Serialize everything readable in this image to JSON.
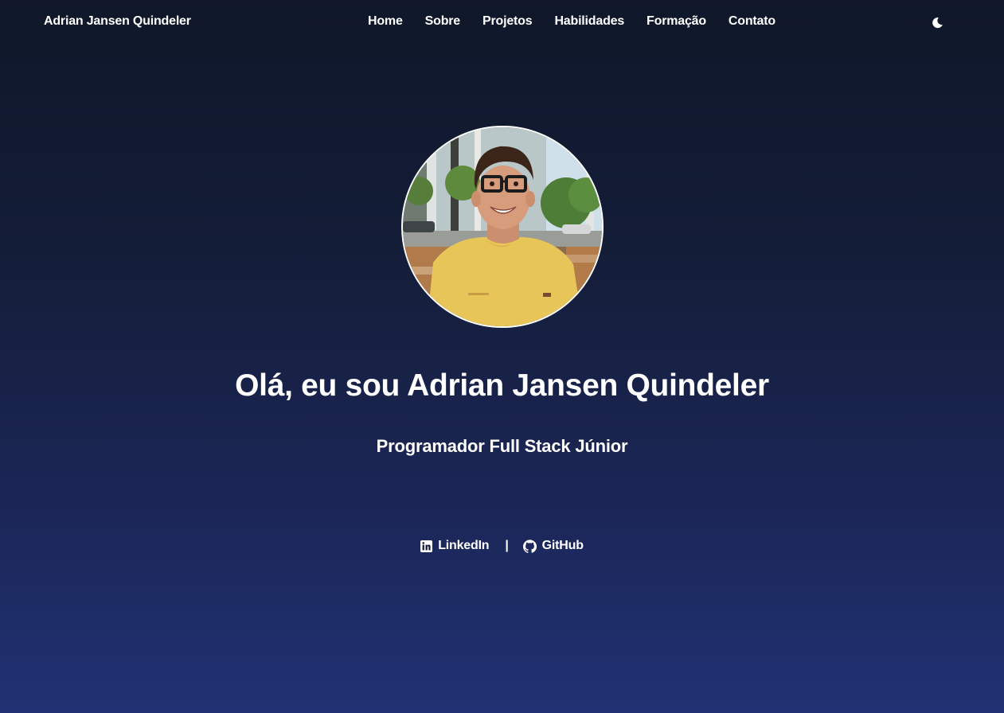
{
  "header": {
    "brand": "Adrian Jansen Quindeler",
    "nav": [
      "Home",
      "Sobre",
      "Projetos",
      "Habilidades",
      "Formação",
      "Contato"
    ],
    "theme_toggle_icon": "moon-icon"
  },
  "hero": {
    "title": "Olá, eu sou Adrian Jansen Quindeler",
    "subtitle": "Programador Full Stack Júnior",
    "links": [
      {
        "label": "LinkedIn",
        "icon": "linkedin-icon"
      },
      {
        "label": "GitHub",
        "icon": "github-icon"
      }
    ],
    "separator": "|"
  },
  "colors": {
    "background_top": "#0f1729",
    "background_bottom": "#213274",
    "text": "#ffffff",
    "shirt": "#e8c559"
  }
}
